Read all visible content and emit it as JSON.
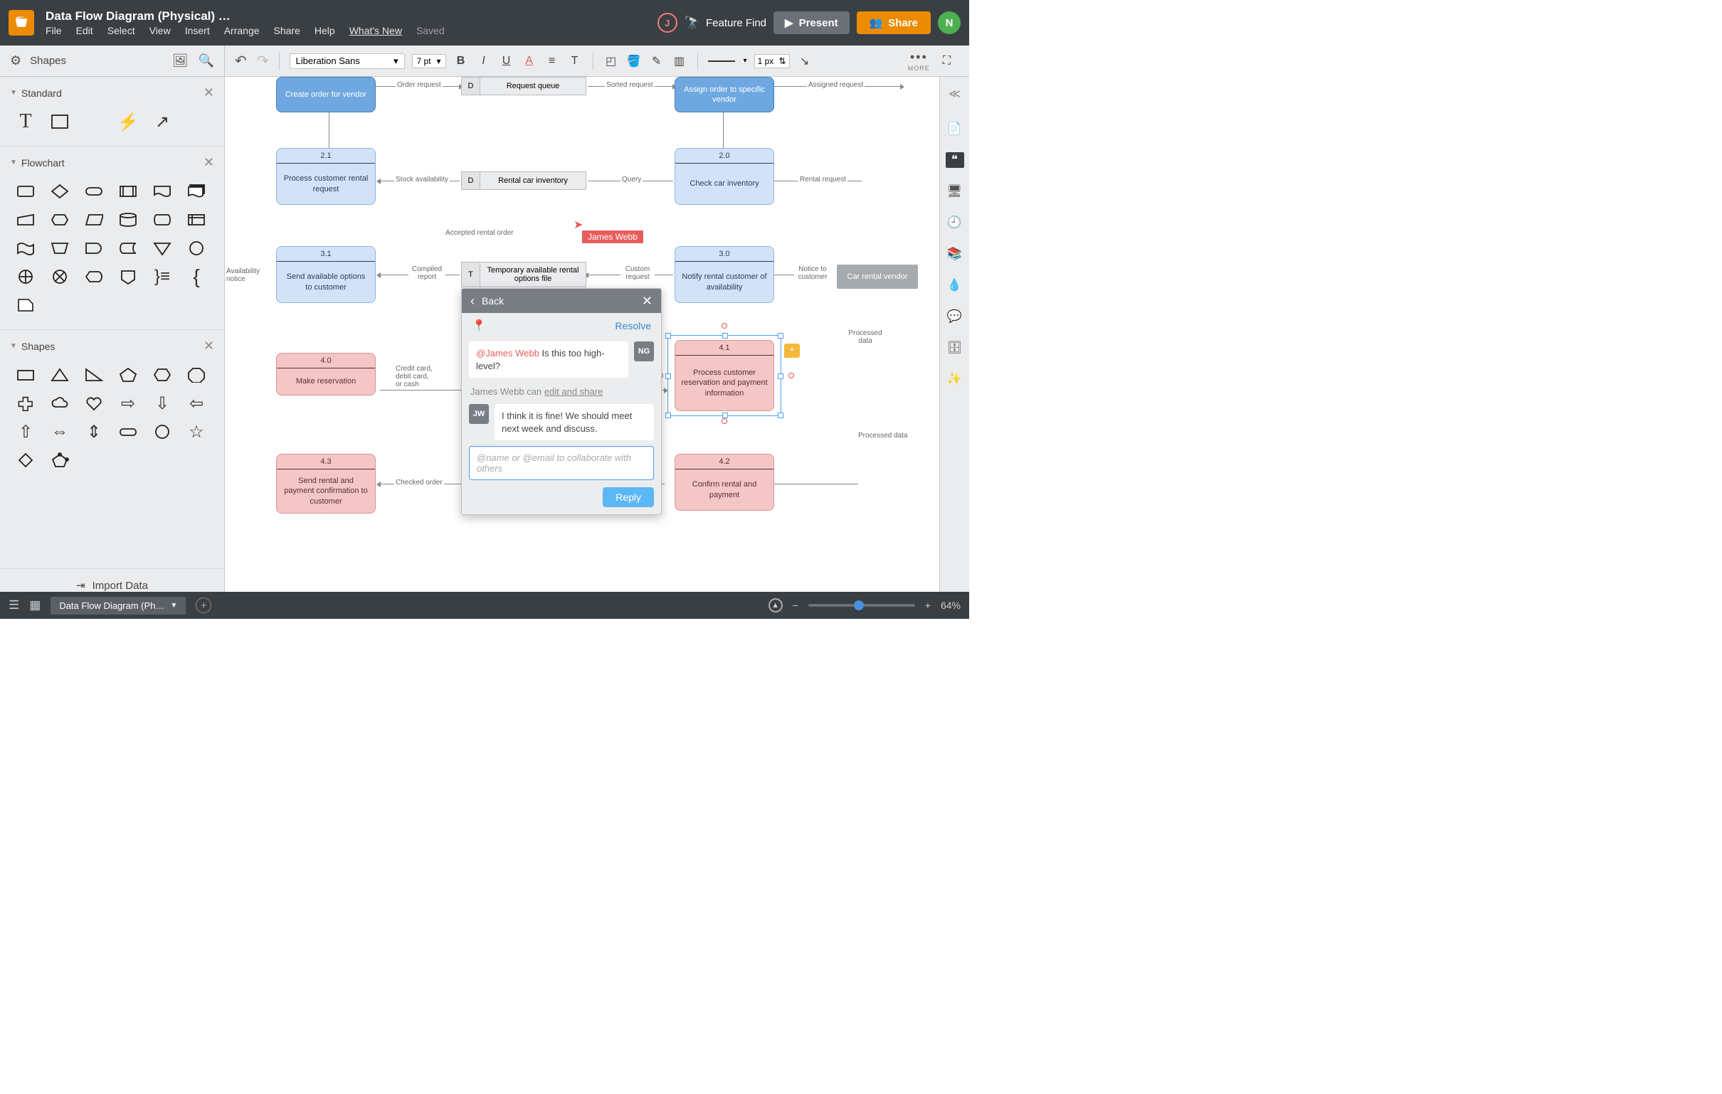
{
  "header": {
    "doc_title": "Data Flow Diagram (Physical) …",
    "menus": [
      "File",
      "Edit",
      "Select",
      "View",
      "Insert",
      "Arrange",
      "Share",
      "Help"
    ],
    "whats_new": "What's New",
    "saved": "Saved",
    "feature_find": "Feature Find",
    "present": "Present",
    "share": "Share",
    "avatar_j": "J",
    "avatar_n": "N"
  },
  "toolbar": {
    "shapes_label": "Shapes",
    "font": "Liberation Sans",
    "pt": "7 pt",
    "line_width": "1 px",
    "more": "MORE"
  },
  "sidebar": {
    "groups": {
      "standard": "Standard",
      "flowchart": "Flowchart",
      "shapes": "Shapes"
    },
    "import_data": "Import Data"
  },
  "canvas": {
    "cursor_user": "James Webb",
    "boxes": {
      "b1": {
        "num": "",
        "label": "Create order for vendor"
      },
      "b2": {
        "num": "",
        "label": "Assign order to specific vendor"
      },
      "b21": {
        "num": "2.1",
        "label": "Process customer rental request"
      },
      "b20": {
        "num": "2.0",
        "label": "Check car inventory"
      },
      "b31": {
        "num": "3.1",
        "label": "Send available options to customer"
      },
      "b30": {
        "num": "3.0",
        "label": "Notify rental customer of availability"
      },
      "b40": {
        "num": "4.0",
        "label": "Make reservation"
      },
      "b41": {
        "num": "4.1",
        "label": "Process customer reservation and payment information"
      },
      "b43": {
        "num": "4.3",
        "label": "Send rental and payment confirmation to customer"
      },
      "b42": {
        "num": "4.2",
        "label": "Confirm rental and payment"
      }
    },
    "stores": {
      "s1": {
        "tag": "D",
        "label": "Request queue"
      },
      "s2": {
        "tag": "D",
        "label": "Rental car inventory"
      },
      "s3": {
        "tag": "T",
        "label": "Temporary available rental options file"
      }
    },
    "vendor": "Car rental vendor",
    "edges": {
      "order_request": "Order request",
      "sorted_request": "Sorted request",
      "assigned_request": "Assigned request",
      "stock_availability": "Stock availability",
      "query": "Query",
      "rental_request": "Rental request",
      "accepted_rental_order": "Accepted rental order",
      "compiled_report": "Compiled report",
      "custom_request": "Custom request",
      "notice_to_customer": "Notice to customer",
      "availability_notice": "Availability notice",
      "credit_note": "Credit card, debit card, or cash",
      "checked_order": "Checked order",
      "processed_data": "Processed data",
      "processed_data2": "Processed data"
    }
  },
  "comment": {
    "back": "Back",
    "resolve": "Resolve",
    "c1": {
      "avatar": "NG",
      "mention": "@James Webb",
      "text": " Is this too high-level?"
    },
    "perm_user": "James Webb can ",
    "perm_action": "edit and share",
    "c2": {
      "avatar": "JW",
      "text": "I think it is fine! We should meet next week and discuss."
    },
    "reply_placeholder": "@name or @email to collaborate with others",
    "reply": "Reply"
  },
  "bottom": {
    "page_tab": "Data Flow Diagram (Ph…",
    "zoom": "64%"
  }
}
